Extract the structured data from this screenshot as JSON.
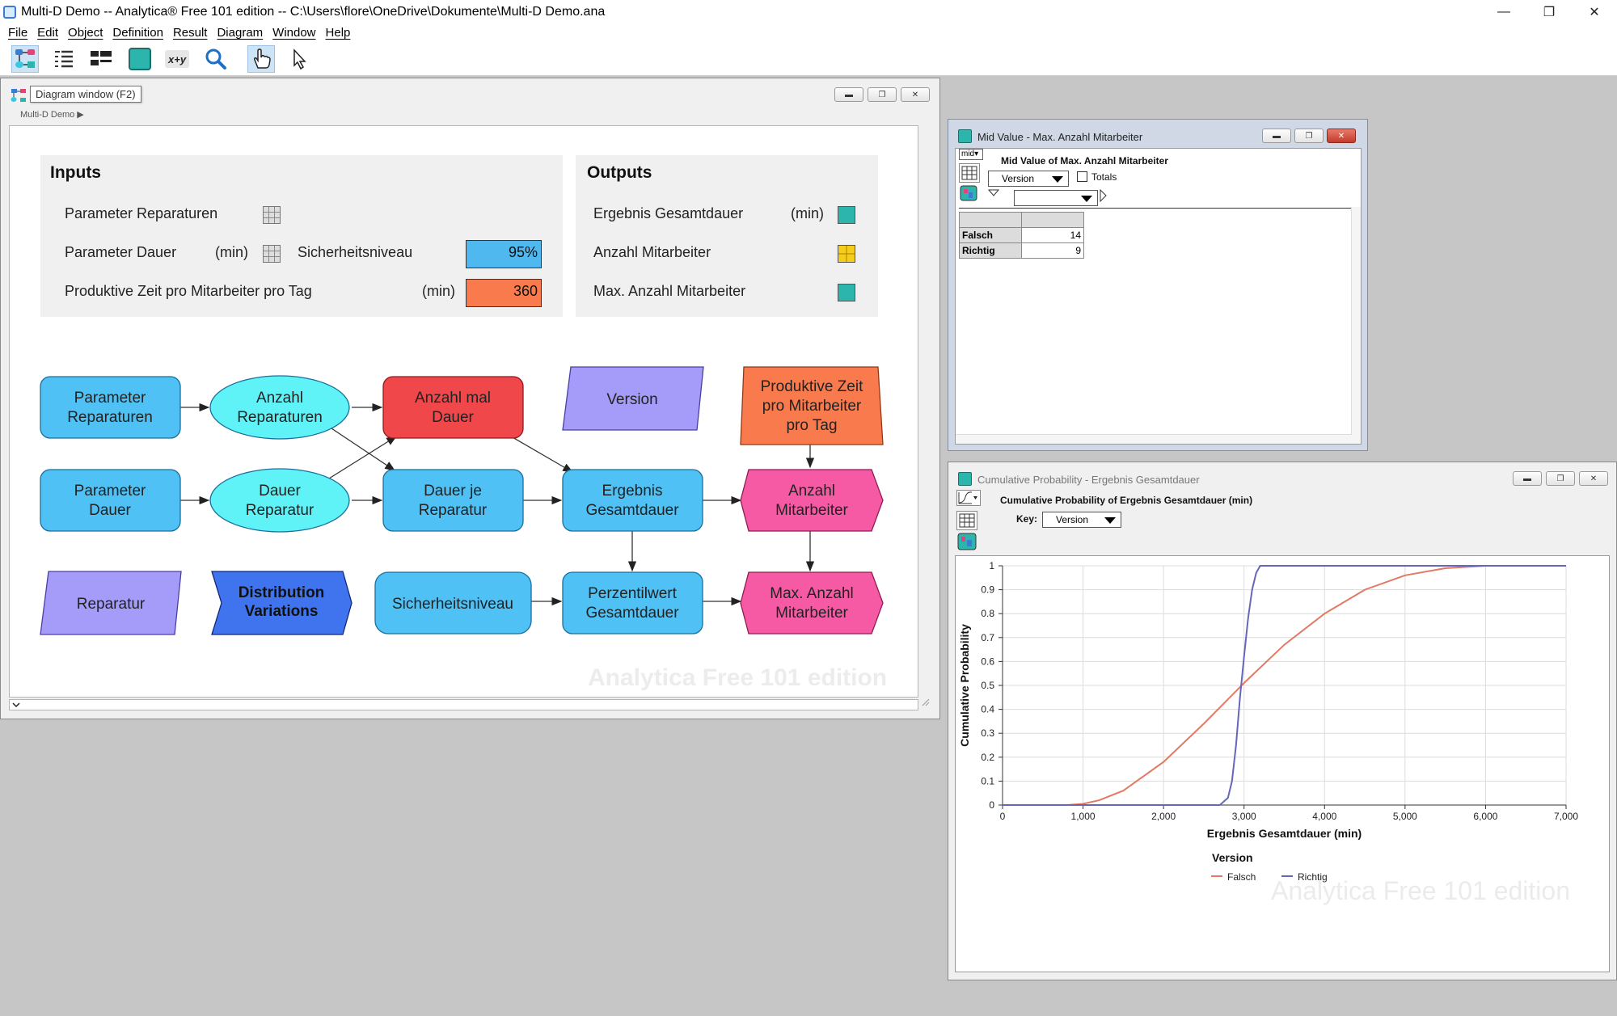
{
  "window": {
    "title": "Multi-D Demo -- Analytica® Free 101 edition -- C:\\Users\\flore\\OneDrive\\Dokumente\\Multi-D Demo.ana",
    "controls": [
      "—",
      "❐",
      "✕"
    ]
  },
  "menu": [
    "File",
    "Edit",
    "Object",
    "Definition",
    "Result",
    "Diagram",
    "Window",
    "Help"
  ],
  "toolbar": {
    "icons": [
      "diagram-icon",
      "outline-icon",
      "attribute-panel-icon",
      "result-icon",
      "expression-icon",
      "find-icon",
      "browse-hand-icon",
      "edit-arrow-icon"
    ],
    "expr_label": "x+y"
  },
  "diagram": {
    "tooltip": "Diagram window (F2)",
    "breadcrumb": "Multi-D Demo",
    "watermark": "Analytica Free 101 edition",
    "inputs": {
      "title": "Inputs",
      "param_rep": "Parameter Reparaturen",
      "param_dauer": "Parameter Dauer",
      "param_dauer_unit": "(min)",
      "sicherheit": "Sicherheitsniveau",
      "sicherheit_value": "95%",
      "prod_zeit": "Produktive Zeit pro Mitarbeiter pro Tag",
      "prod_zeit_unit": "(min)",
      "prod_zeit_value": "360"
    },
    "outputs": {
      "title": "Outputs",
      "ergebnis": "Ergebnis Gesamtdauer",
      "ergebnis_unit": "(min)",
      "anzahl": "Anzahl Mitarbeiter",
      "max_anzahl": "Max. Anzahl Mitarbeiter"
    },
    "nodes": {
      "param_rep": [
        "Parameter",
        "Reparaturen"
      ],
      "anzahl_rep": [
        "Anzahl",
        "Reparaturen"
      ],
      "anzahl_mal": [
        "Anzahl mal",
        "Dauer"
      ],
      "version": [
        "Version"
      ],
      "prod_zeit": [
        "Produktive Zeit",
        "pro Mitarbeiter",
        "pro Tag"
      ],
      "param_dauer": [
        "Parameter",
        "Dauer"
      ],
      "dauer_rep": [
        "Dauer",
        "Reparatur"
      ],
      "dauer_je": [
        "Dauer je",
        "Reparatur"
      ],
      "ergebnis": [
        "Ergebnis",
        "Gesamtdauer"
      ],
      "anzahl_mit": [
        "Anzahl",
        "Mitarbeiter"
      ],
      "reparatur": [
        "Reparatur"
      ],
      "distribution": [
        "Distribution",
        "Variations"
      ],
      "sicherheit": [
        "Sicherheitsniveau"
      ],
      "perzentil": [
        "Perzentilwert",
        "Gesamtdauer"
      ],
      "max_anzahl": [
        "Max. Anzahl",
        "Mitarbeiter"
      ]
    },
    "colors": {
      "blue": "#4fc1f5",
      "cyan": "#5ff3f8",
      "red": "#f0474b",
      "lavender": "#a49cf8",
      "orange": "#f97a4d",
      "magenta": "#f75aa4",
      "dark_blue": "#3f74ee",
      "teal": "#2bb5ad",
      "yellow": "#f5cc1a",
      "panel": "#f0f0f0"
    }
  },
  "midvalue": {
    "title": "Mid Value - Max. Anzahl Mitarbeiter",
    "mode": "mid",
    "heading": "Mid Value of Max. Anzahl Mitarbeiter",
    "index": "Version",
    "totals_label": "Totals",
    "rows": [
      {
        "label": "Falsch",
        "value": "14"
      },
      {
        "label": "Richtig",
        "value": "9"
      }
    ]
  },
  "cumprob": {
    "title": "Cumulative Probability - Ergebnis Gesamtdauer",
    "heading": "Cumulative Probability of Ergebnis Gesamtdauer (min)",
    "key_label": "Key:",
    "key_value": "Version",
    "watermark": "Analytica Free 101 edition"
  },
  "chart_data": {
    "type": "line",
    "title": "Cumulative Probability of Ergebnis Gesamtdauer (min)",
    "xlabel": "Ergebnis Gesamtdauer (min)",
    "ylabel": "Cumulative Probability",
    "xlim": [
      0,
      7000
    ],
    "ylim": [
      0,
      1
    ],
    "xticks": [
      "0",
      "1,000",
      "2,000",
      "3,000",
      "4,000",
      "5,000",
      "6,000",
      "7,000"
    ],
    "yticks": [
      "0",
      "0.1",
      "0.2",
      "0.3",
      "0.4",
      "0.5",
      "0.6",
      "0.7",
      "0.8",
      "0.9",
      "1"
    ],
    "grid": true,
    "legend_title": "Version",
    "legend_position": "bottom",
    "series": [
      {
        "name": "Falsch",
        "color": "#e07a64",
        "x": [
          0,
          800,
          1000,
          1200,
          1500,
          2000,
          2500,
          3000,
          3500,
          4000,
          4500,
          5000,
          5500,
          6000,
          6500,
          7000
        ],
        "y": [
          0,
          0,
          0.005,
          0.02,
          0.06,
          0.18,
          0.34,
          0.51,
          0.67,
          0.8,
          0.9,
          0.96,
          0.99,
          1,
          1,
          1
        ]
      },
      {
        "name": "Richtig",
        "color": "#6666bb",
        "x": [
          0,
          2700,
          2800,
          2850,
          2900,
          2950,
          3000,
          3050,
          3100,
          3150,
          3200,
          3300,
          7000
        ],
        "y": [
          0,
          0,
          0.03,
          0.1,
          0.25,
          0.45,
          0.62,
          0.78,
          0.9,
          0.97,
          1,
          1,
          1
        ]
      }
    ]
  }
}
